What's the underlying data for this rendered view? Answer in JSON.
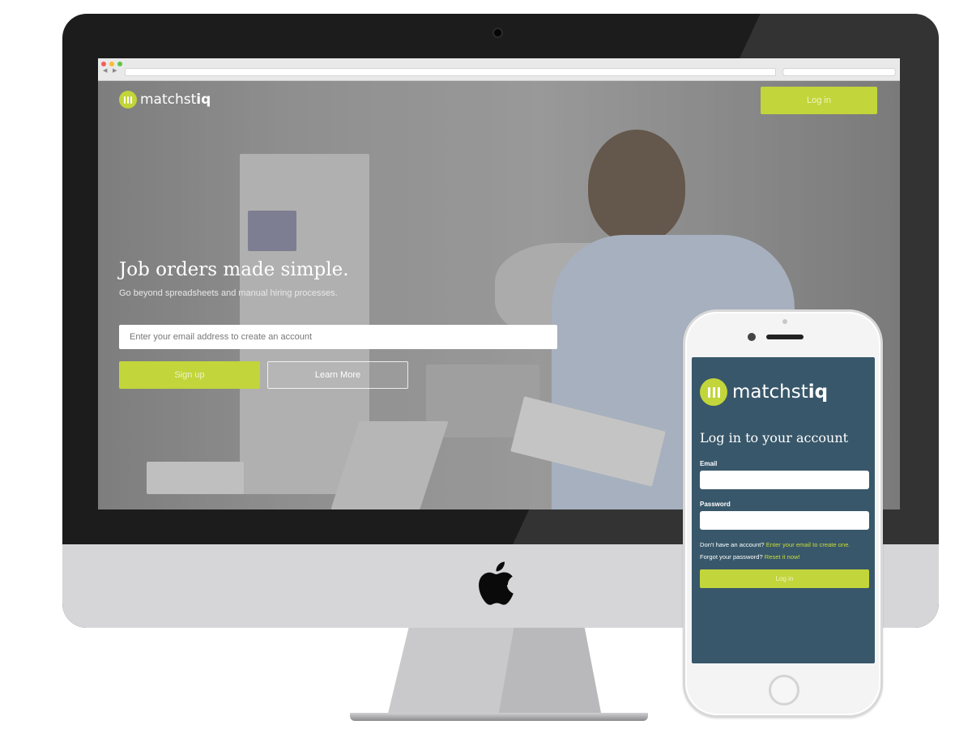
{
  "desktop": {
    "brand": {
      "name_light": "matchst",
      "name_bold": "iq"
    },
    "login_button": "Log in",
    "hero": {
      "title": "Job orders made simple.",
      "subtitle": "Go beyond spreadsheets and manual hiring processes.",
      "email_placeholder": "Enter your email address to create an account",
      "signup_button": "Sign up",
      "learn_more_button": "Learn More"
    }
  },
  "mobile": {
    "brand": {
      "name_light": "matchst",
      "name_bold": "iq"
    },
    "title": "Log in to your account",
    "email_label": "Email",
    "password_label": "Password",
    "no_account_text": "Don't have an account?",
    "no_account_link": "Enter your email to create one.",
    "forgot_text": "Forgot your password?",
    "forgot_link": "Reset it now!",
    "login_button": "Log in"
  },
  "colors": {
    "accent": "#c2d53a",
    "mobile_bg": "#38576a",
    "link": "#c8dc3c"
  }
}
